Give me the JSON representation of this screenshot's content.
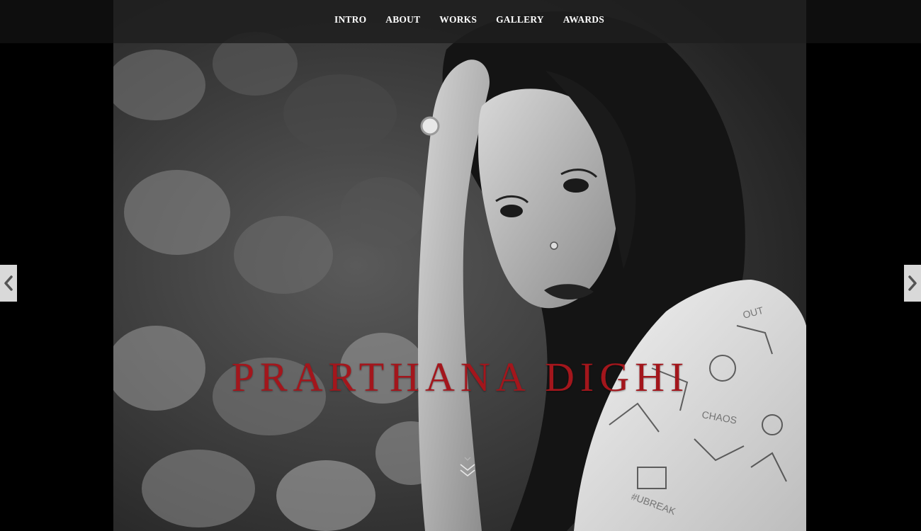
{
  "nav": {
    "items": [
      {
        "label": "INTRO"
      },
      {
        "label": "ABOUT"
      },
      {
        "label": "WORKS"
      },
      {
        "label": "GALLERY"
      },
      {
        "label": "AWARDS"
      }
    ]
  },
  "hero": {
    "title": "PRARTHANA DIGHI",
    "title_color": "#a3161c"
  },
  "controls": {
    "prev_icon": "chevron-left-icon",
    "next_icon": "chevron-right-icon",
    "scroll_icon": "double-chevron-down-icon"
  }
}
